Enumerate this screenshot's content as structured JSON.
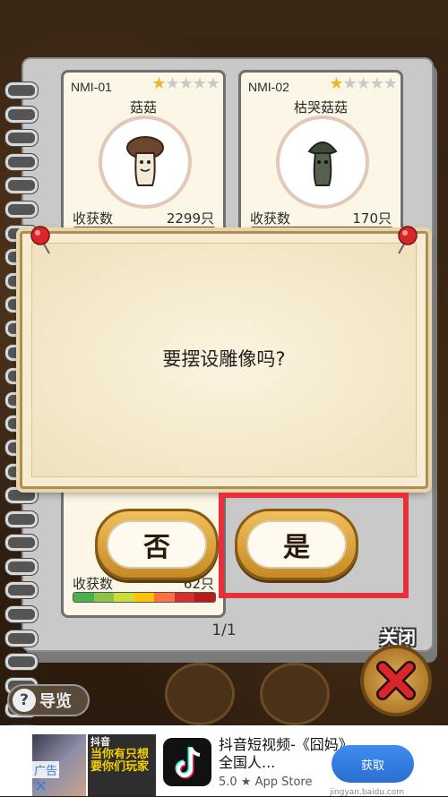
{
  "game": {
    "cards": [
      {
        "code": "NMI-01",
        "stars_filled": 1,
        "stars_total": 5,
        "name": "菇菇",
        "harvest_label": "收获数",
        "harvest_value": "2299只"
      },
      {
        "code": "NMI-02",
        "stars_filled": 1,
        "stars_total": 5,
        "name": "枯哭菇菇",
        "harvest_label": "收获数",
        "harvest_value": "170只"
      },
      {
        "harvest_label": "收获数",
        "harvest_value": "62只"
      }
    ],
    "page_indicator": "1/1",
    "close_label": "关闭",
    "guide_icon": "?",
    "guide_label": "导览"
  },
  "dialog": {
    "message": "要摆设雕像吗?",
    "no_label": "否",
    "yes_label": "是"
  },
  "ad": {
    "ad_label": "广告",
    "close_glyph": "✕",
    "game_tag": "抖音",
    "game_text": "当你有只想要你们玩家",
    "app_title": "抖音短视频-《囧妈》全国人...",
    "rating": "5.0 ★ App Store",
    "button_text": "获取",
    "watermark": "jingyan.baidu.com"
  },
  "colors": {
    "highlight_border": "#e8303a",
    "star_on": "#e8b820",
    "button_gold": "#d9a040"
  }
}
